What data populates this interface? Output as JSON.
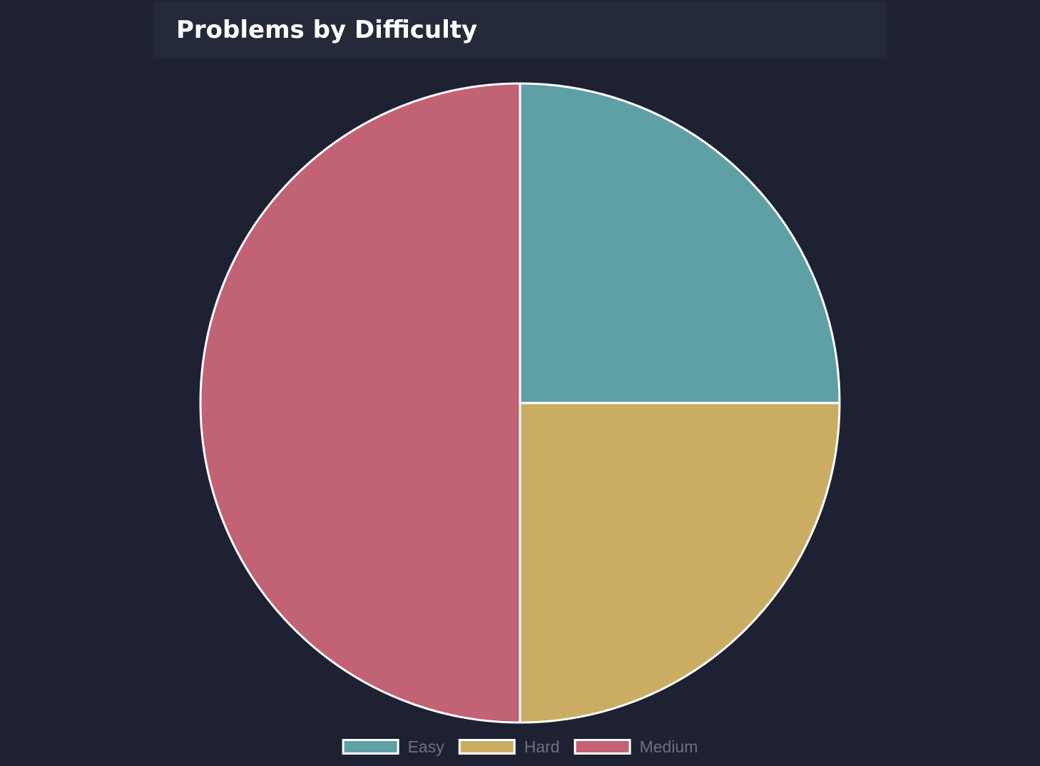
{
  "panel": {
    "title": "Problems by Difficulty"
  },
  "chart_data": {
    "type": "pie",
    "title": "Problems by Difficulty",
    "labels": [
      "Easy",
      "Hard",
      "Medium"
    ],
    "values": [
      1,
      1,
      2
    ],
    "colors": [
      "#5f9fa6",
      "#caad62",
      "#c26275"
    ],
    "border_color": "#ffffff",
    "legend_position": "bottom"
  }
}
